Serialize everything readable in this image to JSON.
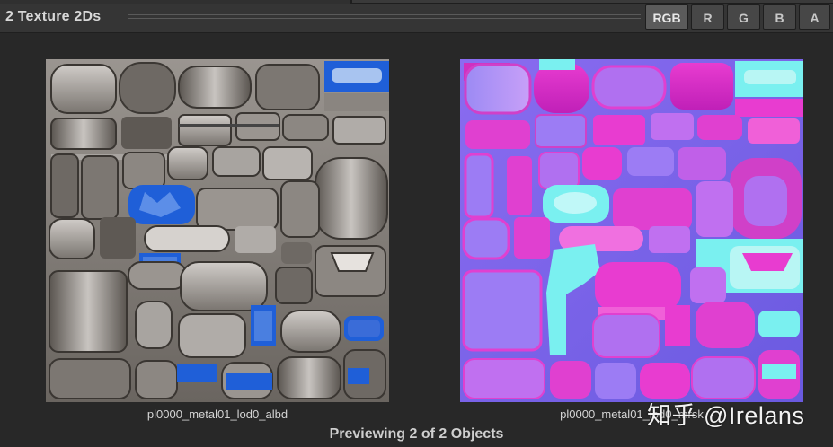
{
  "window": {
    "title": "2 Texture 2Ds"
  },
  "channels": {
    "buttons": [
      {
        "label": "RGB",
        "active": true
      },
      {
        "label": "R",
        "active": false
      },
      {
        "label": "G",
        "active": false
      },
      {
        "label": "B",
        "active": false
      },
      {
        "label": "A",
        "active": false
      }
    ]
  },
  "previews": [
    {
      "label": "pl0000_metal01_lod0_albd",
      "style": "albedo-grey-metal"
    },
    {
      "label": "pl0000_metal01_lod0_mrsk",
      "style": "mask-pink-blue"
    }
  ],
  "footer": {
    "status": "Previewing 2 of 2 Objects"
  },
  "watermark": {
    "text": "知乎 @Irelans"
  },
  "colors": {
    "background": "#282828",
    "header": "#353535",
    "albedo_blue": "#1f5fd8",
    "mask_magenta": "#e020c8",
    "mask_violet": "#8a6cf0",
    "mask_cyan": "#7af0f0"
  }
}
